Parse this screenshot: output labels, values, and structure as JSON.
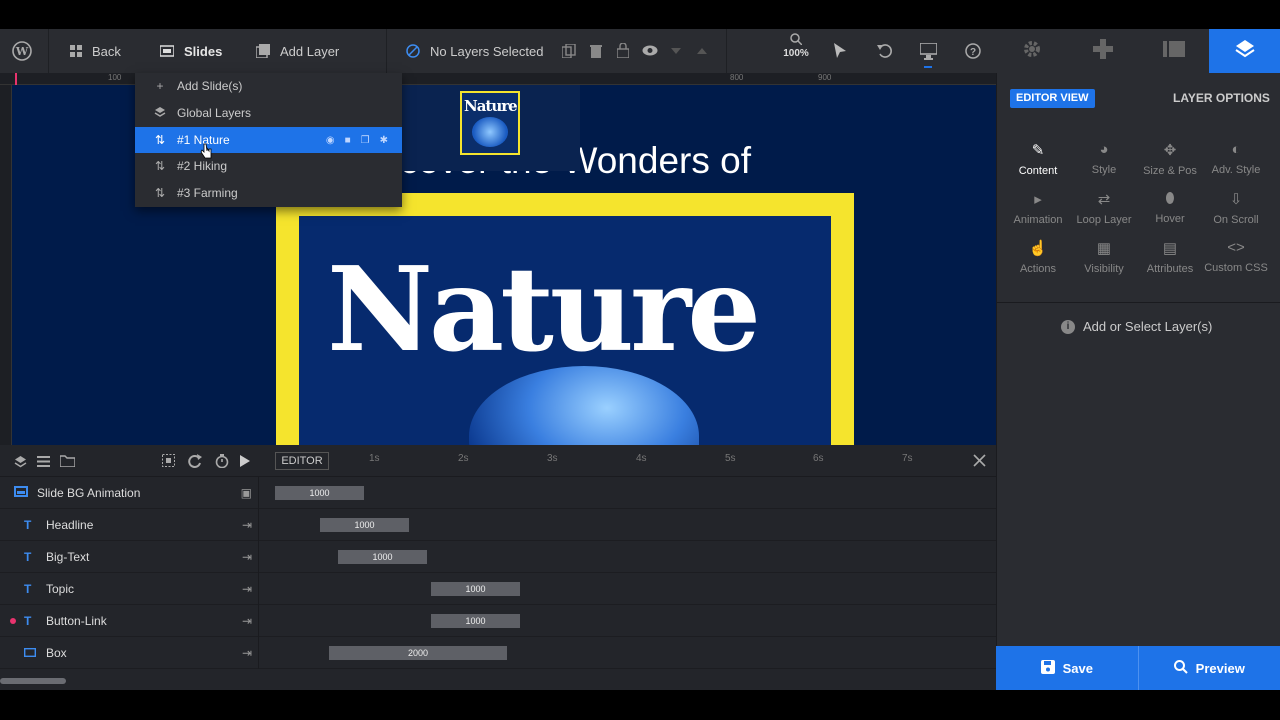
{
  "toolbar": {
    "back": "Back",
    "slides": "Slides",
    "add_layer": "Add Layer",
    "no_layers": "No Layers Selected",
    "zoom": "100%"
  },
  "slides_menu": {
    "add_slides": "Add Slide(s)",
    "global_layers": "Global Layers",
    "items": [
      "#1 Nature",
      "#2 Hiking",
      "#3 Farming"
    ]
  },
  "canvas": {
    "headline": "cover the Wonders of",
    "big_text": "Nature",
    "thumb_title": "Nature",
    "ruler_top": [
      "100",
      "800",
      "900"
    ]
  },
  "right_panel": {
    "editor_view": "EDITOR VIEW",
    "layer_options": "LAYER OPTIONS",
    "options": [
      "Content",
      "Style",
      "Size & Pos",
      "Adv. Style",
      "Animation",
      "Loop Layer",
      "Hover",
      "On Scroll",
      "Actions",
      "Visibility",
      "Attributes",
      "Custom CSS"
    ],
    "empty_message": "Add or Select Layer(s)",
    "save": "Save",
    "preview": "Preview"
  },
  "timeline": {
    "editor_tag": "EDITOR",
    "ticks": [
      "1s",
      "2s",
      "3s",
      "4s",
      "5s",
      "6s",
      "7s"
    ],
    "rows": [
      {
        "name": "Slide BG Animation",
        "value": "1000"
      },
      {
        "name": "Headline",
        "value": "1000"
      },
      {
        "name": "Big-Text",
        "value": "1000"
      },
      {
        "name": "Topic",
        "value": "1000"
      },
      {
        "name": "Button-Link",
        "value": "1000"
      },
      {
        "name": "Box",
        "value": "2000"
      }
    ]
  },
  "colors": {
    "accent": "#1e73e8",
    "box_yellow": "#f5e42d",
    "canvas_bg": "#001b4a"
  }
}
